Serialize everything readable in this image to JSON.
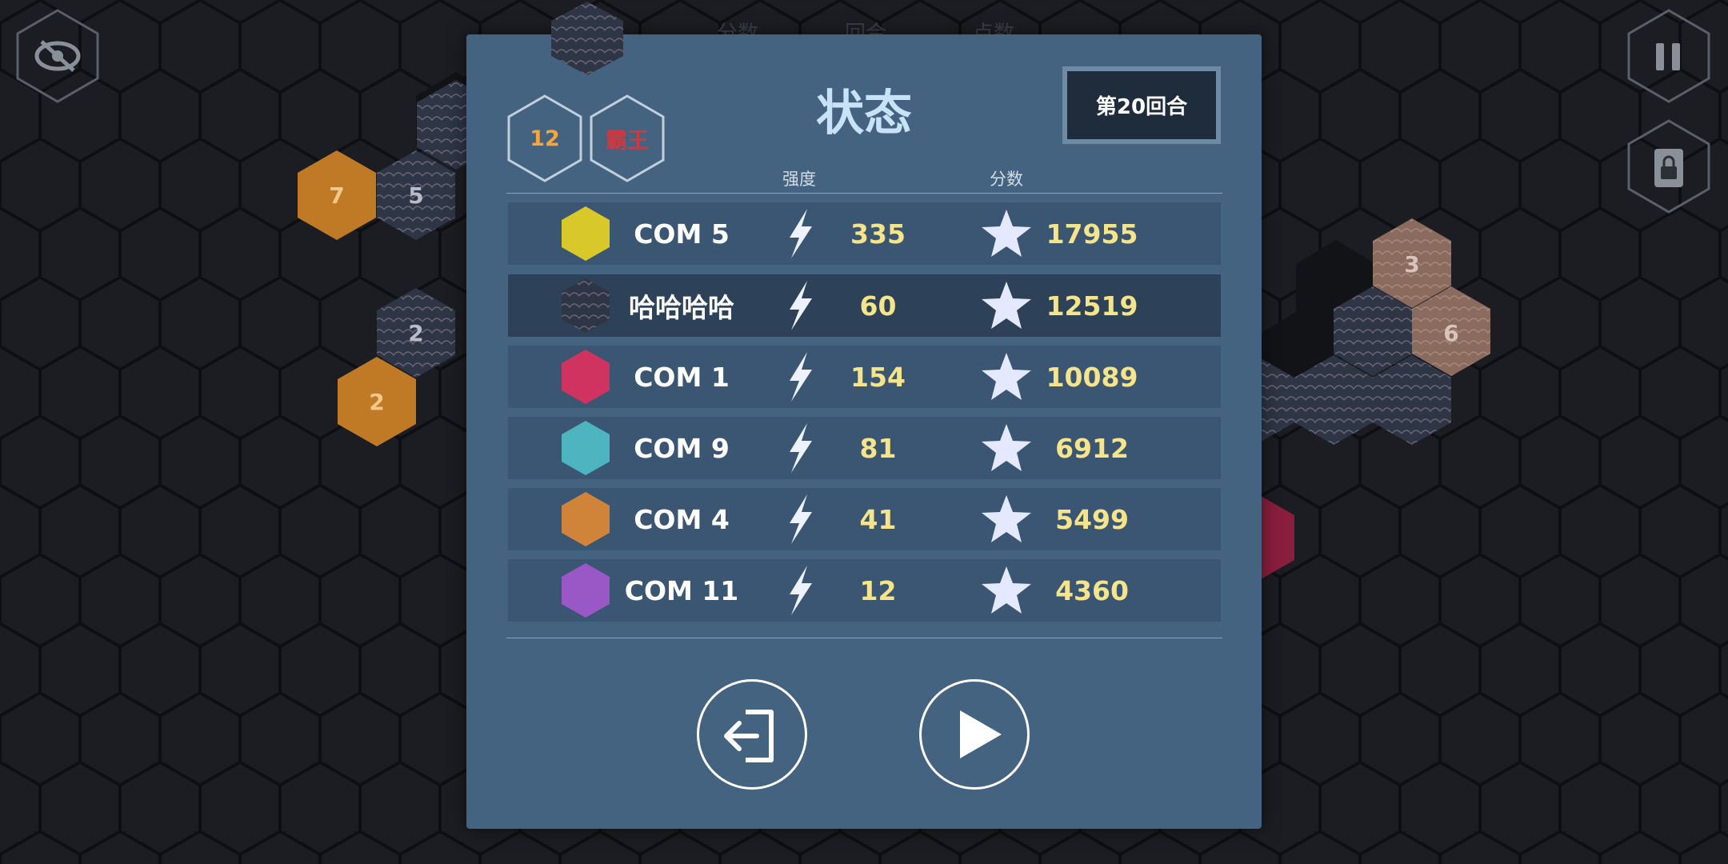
{
  "background": {
    "tiles": [
      {
        "label": "7",
        "color": "#c07a25"
      },
      {
        "label": "5",
        "color": "pattern"
      },
      {
        "label": "2",
        "color": "pattern"
      },
      {
        "label": "2",
        "color": "#c07a25"
      },
      {
        "label": "3",
        "color": "#8c6b5f"
      },
      {
        "label": "6",
        "color": "#8c6b5f"
      }
    ]
  },
  "controls": {
    "hide_icon": "eye-off-icon",
    "pause_icon": "pause-icon",
    "lock_icon": "lock-icon"
  },
  "background_header": [
    "分数",
    "回合",
    "点数"
  ],
  "status_panel": {
    "title": "状态",
    "badge_count": "12",
    "badge_mode": "霸王",
    "round_label": "第20回合",
    "columns": {
      "strength": "强度",
      "score": "分数"
    },
    "players": [
      {
        "name": "COM 5",
        "color": "#d8c82a",
        "strength": "335",
        "score": "17955",
        "current": false
      },
      {
        "name": "哈哈哈哈",
        "color": "pattern",
        "strength": "60",
        "score": "12519",
        "current": true
      },
      {
        "name": "COM 1",
        "color": "#d13360",
        "strength": "154",
        "score": "10089",
        "current": false
      },
      {
        "name": "COM 9",
        "color": "#4eb4c0",
        "strength": "81",
        "score": "6912",
        "current": false
      },
      {
        "name": "COM 4",
        "color": "#d0843a",
        "strength": "41",
        "score": "5499",
        "current": false
      },
      {
        "name": "COM 11",
        "color": "#9a57c6",
        "strength": "12",
        "score": "4360",
        "current": false
      }
    ],
    "exit_icon": "exit-icon",
    "play_icon": "play-icon"
  }
}
